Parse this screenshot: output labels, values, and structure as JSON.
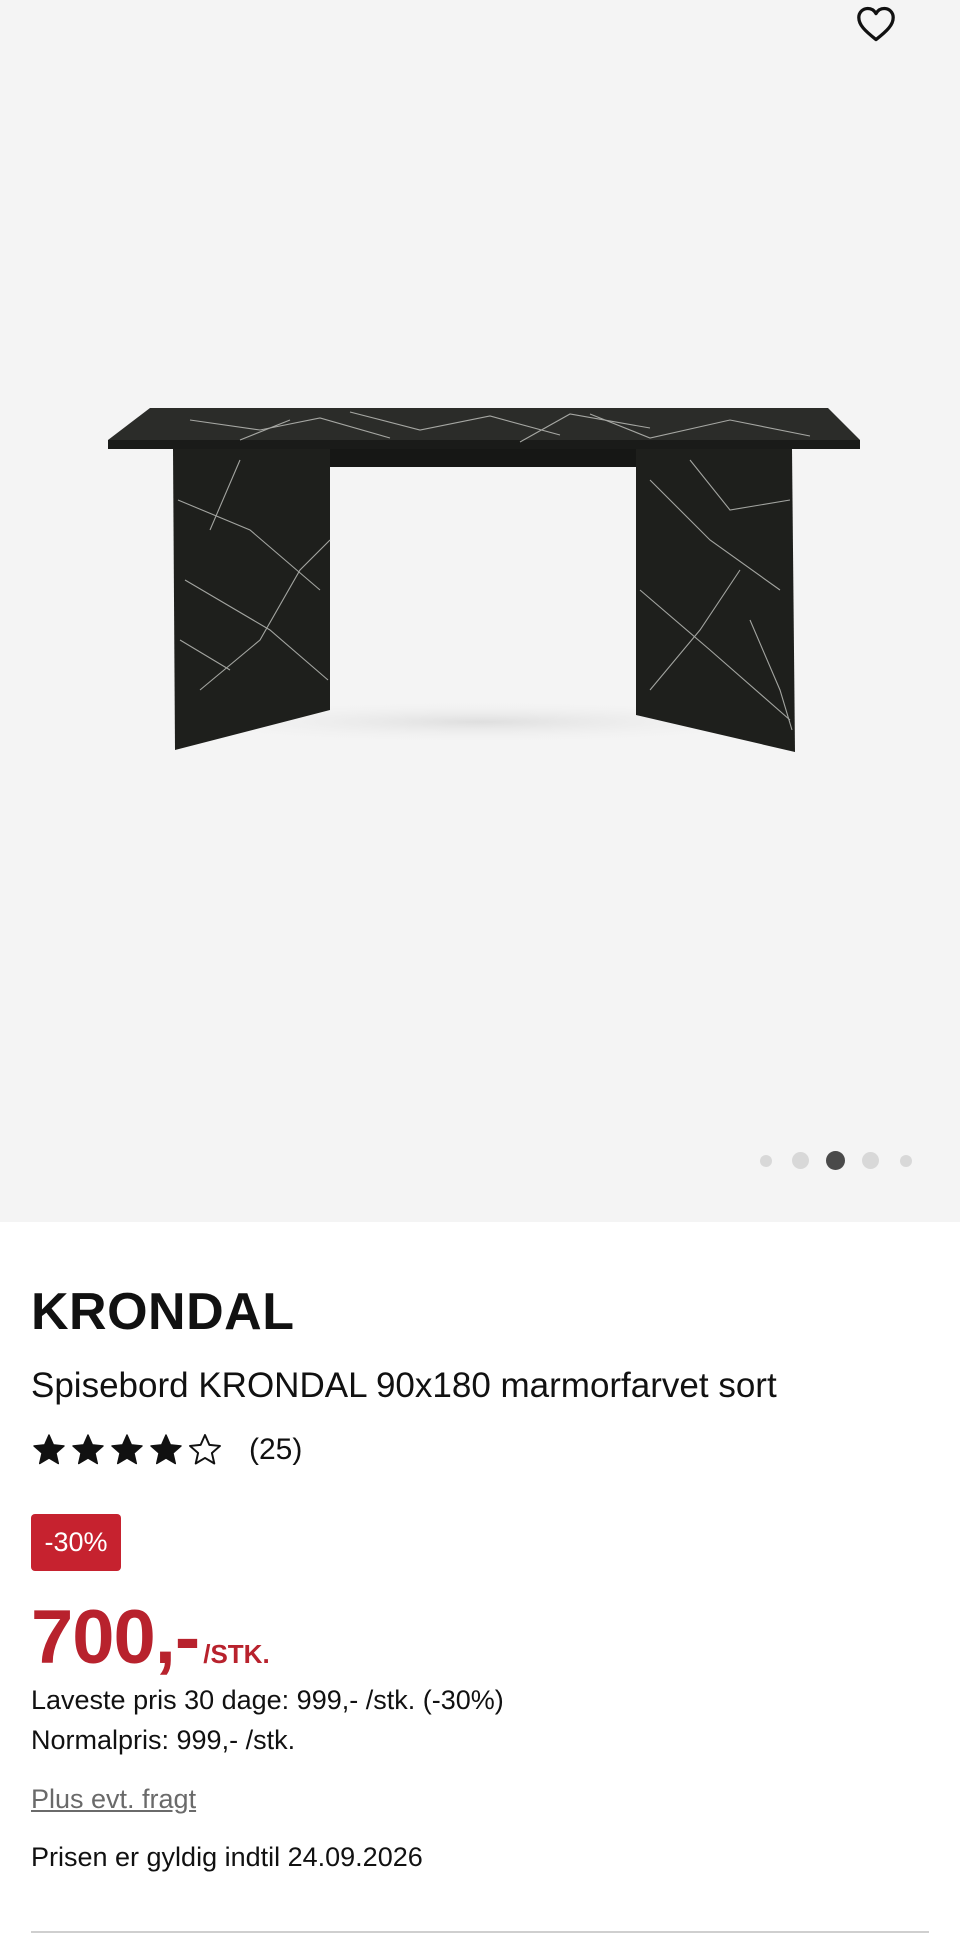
{
  "gallery": {
    "favorite_icon": "heart-outline-icon",
    "image_alt": "Spisebord KRONDAL marmorfarvet sort",
    "dots_total": 5,
    "active_dot_index": 2
  },
  "product": {
    "brand": "KRONDAL",
    "name": "Spisebord KRONDAL 90x180 marmorfarvet sort",
    "rating": 4,
    "rating_max": 5,
    "review_count": "(25)",
    "discount_badge": "-30%",
    "price": "700,-",
    "price_unit": "/STK.",
    "lowest_price_text": "Laveste pris 30 dage: 999,- /stk. (-30%)",
    "normal_price_text": "Normalpris: 999,- /stk.",
    "shipping_link": "Plus evt. fragt",
    "valid_until_text": "Prisen er gyldig indtil 24.09.2026"
  },
  "colors": {
    "gallery_bg": "#f4f4f4",
    "sale_red": "#c6222f",
    "price_red": "#b8222d",
    "dot_active": "#4a4a4a",
    "dot_inactive": "#d8d8d8"
  }
}
